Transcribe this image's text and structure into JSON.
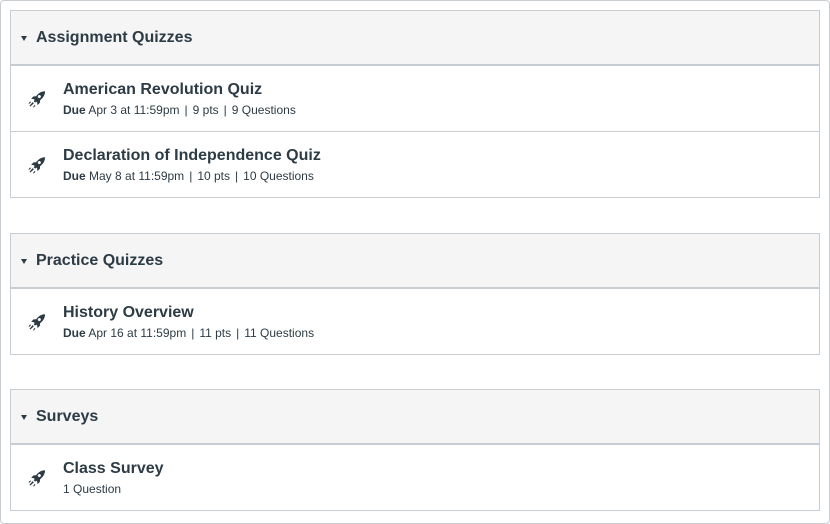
{
  "groups": [
    {
      "title": "Assignment Quizzes",
      "items": [
        {
          "title": "American Revolution Quiz",
          "due_label": "Due",
          "due": "Apr 3 at 11:59pm",
          "pts": "9 pts",
          "questions": "9 Questions"
        },
        {
          "title": "Declaration of Independence Quiz",
          "due_label": "Due",
          "due": "May 8 at 11:59pm",
          "pts": "10 pts",
          "questions": "10 Questions"
        }
      ]
    },
    {
      "title": "Practice Quizzes",
      "items": [
        {
          "title": "History Overview",
          "due_label": "Due",
          "due": "Apr 16 at 11:59pm",
          "pts": "11 pts",
          "questions": "11 Questions"
        }
      ]
    },
    {
      "title": "Surveys",
      "items": [
        {
          "title": "Class Survey",
          "questions": "1 Question"
        }
      ]
    }
  ],
  "separator": "|",
  "icons": {
    "item": "rocket-icon",
    "collapse": "caret-down-icon"
  },
  "colors": {
    "text": "#2d3b45",
    "header_bg": "#f5f5f5",
    "border": "#c7cdd1"
  }
}
